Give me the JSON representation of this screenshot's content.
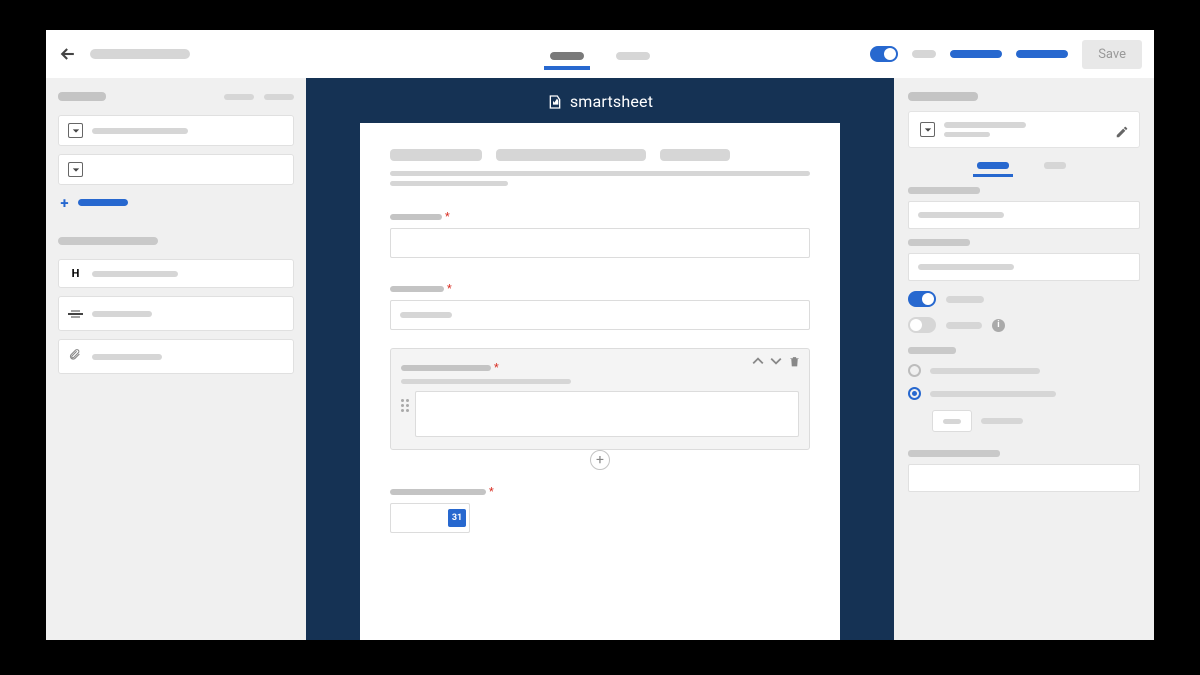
{
  "topbar": {
    "save_label": "Save"
  },
  "brand": {
    "name": "smartsheet"
  },
  "calendar": {
    "day": "31"
  },
  "icons": {
    "header": "H",
    "info": "i"
  }
}
